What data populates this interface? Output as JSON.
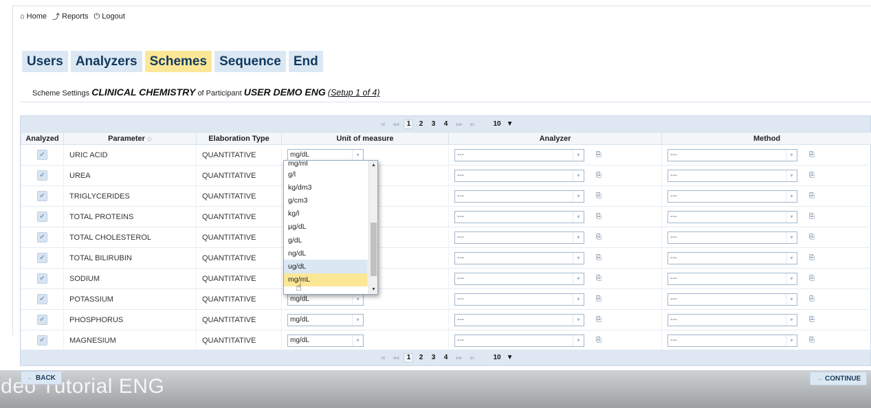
{
  "topnav": [
    {
      "icon": "home-icon",
      "glyph": "⌂",
      "label": "Home"
    },
    {
      "icon": "chart-icon",
      "glyph": "⤴",
      "label": "Reports"
    },
    {
      "icon": "power-icon",
      "glyph": "⏻",
      "label": "Logout"
    }
  ],
  "tabs": [
    {
      "label": "Users",
      "active": false
    },
    {
      "label": "Analyzers",
      "active": false
    },
    {
      "label": "Schemes",
      "active": true
    },
    {
      "label": "Sequence",
      "active": false
    },
    {
      "label": "End",
      "active": false
    }
  ],
  "scheme": {
    "prefix": "Scheme Settings",
    "scheme_name": "CLINICAL CHEMISTRY",
    "middle": "of Participant",
    "participant": "USER DEMO ENG",
    "setup": "(Setup 1 of 4)"
  },
  "pager": {
    "pages": [
      "1",
      "2",
      "3",
      "4"
    ],
    "current_page": "1",
    "rows_per_page": "10",
    "rows_arrow": "▼"
  },
  "columns": {
    "analyzed": "Analyzed",
    "parameter": "Parameter",
    "sort_glyph": "◇",
    "elaboration": "Elaboration Type",
    "unit": "Unit of measure",
    "analyzer": "Analyzer",
    "method": "Method"
  },
  "rows": [
    {
      "parameter": "URIC ACID",
      "type": "QUANTITATIVE",
      "unit": "mg/dL",
      "analyzer": "---",
      "method": "---"
    },
    {
      "parameter": "UREA",
      "type": "QUANTITATIVE",
      "unit": "",
      "analyzer": "---",
      "method": "---"
    },
    {
      "parameter": "TRIGLYCERIDES",
      "type": "QUANTITATIVE",
      "unit": "",
      "analyzer": "---",
      "method": "---"
    },
    {
      "parameter": "TOTAL PROTEINS",
      "type": "QUANTITATIVE",
      "unit": "",
      "analyzer": "---",
      "method": "---"
    },
    {
      "parameter": "TOTAL CHOLESTEROL",
      "type": "QUANTITATIVE",
      "unit": "",
      "analyzer": "---",
      "method": "---"
    },
    {
      "parameter": "TOTAL BILIRUBIN",
      "type": "QUANTITATIVE",
      "unit": "",
      "analyzer": "---",
      "method": "---"
    },
    {
      "parameter": "SODIUM",
      "type": "QUANTITATIVE",
      "unit": "",
      "analyzer": "---",
      "method": "---"
    },
    {
      "parameter": "POTASSIUM",
      "type": "QUANTITATIVE",
      "unit": "mg/dL",
      "analyzer": "---",
      "method": "---"
    },
    {
      "parameter": "PHOSPHORUS",
      "type": "QUANTITATIVE",
      "unit": "mg/dL",
      "analyzer": "---",
      "method": "---"
    },
    {
      "parameter": "MAGNESIUM",
      "type": "QUANTITATIVE",
      "unit": "mg/dL",
      "analyzer": "---",
      "method": "---"
    }
  ],
  "check_glyph": "✔",
  "select_arrow": "▾",
  "copy_glyph": "⎘",
  "unit_dropdown": {
    "options": [
      "mg/ml",
      "g/l",
      "kg/dm3",
      "g/cm3",
      "kg/l",
      "µg/dL",
      "g/dL",
      "ng/dL",
      "ug/dL",
      "mg/mL"
    ],
    "hover_index": 8,
    "selected_index": 9,
    "scroll_up": "▲",
    "scroll_down": "▼",
    "cursor_glyph": "☝"
  },
  "buttons": {
    "back": "BACK",
    "continue": "CONTINUE",
    "back_arrow": "←",
    "continue_arrow": "→"
  },
  "watermark": "ideo Tutorial ENG",
  "colors": {
    "tab_bg": "#dbe8f4",
    "tab_active_bg": "#fbe796",
    "tab_text": "#12395e",
    "header_bar": "#dfe8f2"
  }
}
